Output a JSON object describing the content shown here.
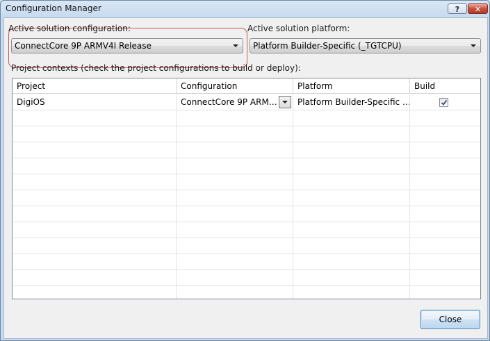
{
  "window": {
    "title": "Configuration Manager",
    "help_label": "?",
    "close_label": "✕"
  },
  "solution_config": {
    "label": "Active solution configuration:",
    "value": "ConnectCore 9P ARMV4I Release"
  },
  "solution_platform": {
    "label": "Active solution platform:",
    "value": "Platform Builder-Specific (_TGTCPU)"
  },
  "project_contexts": {
    "label": "Project contexts (check the project configurations to build or deploy):",
    "columns": [
      "Project",
      "Configuration",
      "Platform",
      "Build"
    ],
    "rows": [
      {
        "project": "DigiOS",
        "configuration": "ConnectCore 9P ARM…",
        "platform": "Platform Builder-Specific …",
        "build": true
      }
    ]
  },
  "footer": {
    "close_label": "Close"
  },
  "colors": {
    "title_bar": "#d9e7f5",
    "highlight_ring": "#c8565a",
    "button_border": "#3c7fb1"
  }
}
